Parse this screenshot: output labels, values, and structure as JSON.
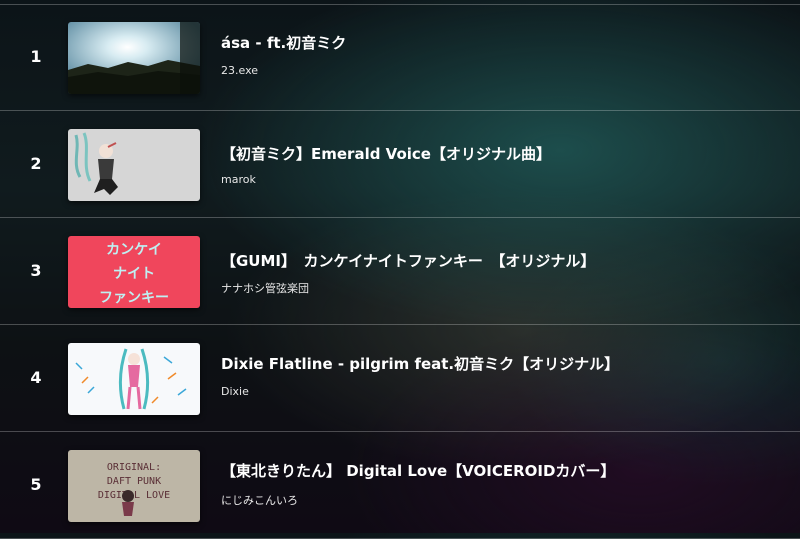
{
  "ranking": [
    {
      "rank": "1",
      "title": "ásа - ft.初音ミク",
      "artist": "23.exe"
    },
    {
      "rank": "2",
      "title": "【初音ミク】Emerald Voice【オリジナル曲】",
      "artist": "marok"
    },
    {
      "rank": "3",
      "title": "【GUMI】　カンケイナイトファンキー　【オリジナル】",
      "artist": "ナナホシ管弦楽団"
    },
    {
      "rank": "4",
      "title": "Dixie Flatline - pilgrim feat.初音ミク【オリジナル】",
      "artist": "Dixie"
    },
    {
      "rank": "5",
      "title": "【東北きりたん】 Digital Love【VOICEROIDカバー】",
      "artist": "にじみこんいろ"
    }
  ],
  "thumb_text": {
    "t3": [
      "カンケイ",
      "ナイト",
      "ファンキー"
    ],
    "t5": [
      "ORIGINAL:",
      "DAFT PUNK",
      "DIGITAL LOVE"
    ]
  }
}
